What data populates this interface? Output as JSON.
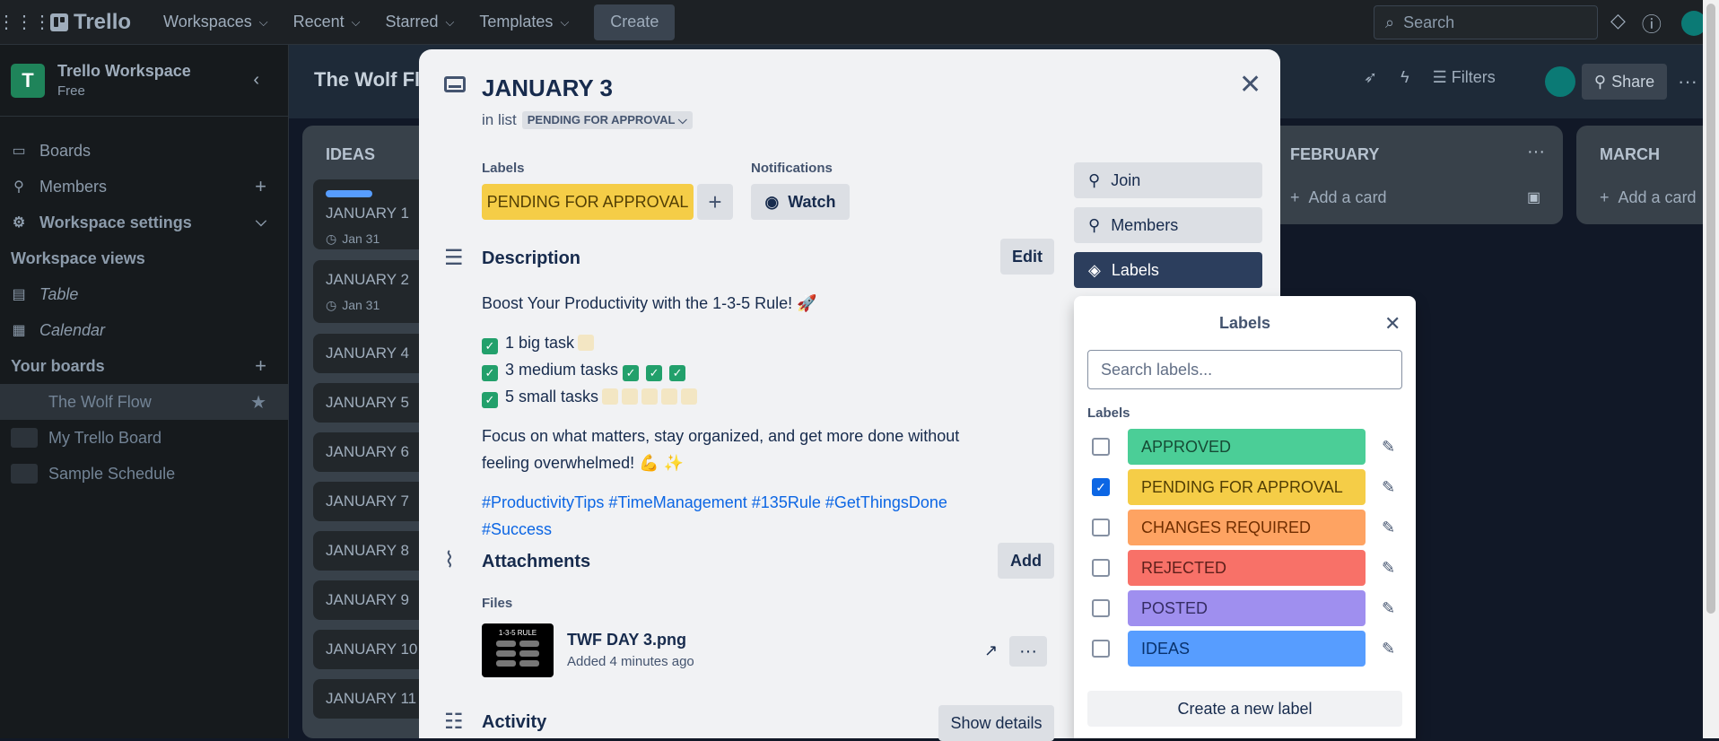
{
  "topbar": {
    "logo": "Trello",
    "nav": [
      "Workspaces",
      "Recent",
      "Starred",
      "Templates"
    ],
    "create": "Create",
    "search_placeholder": "Search"
  },
  "sidebar": {
    "workspace_name": "Trello Workspace",
    "workspace_plan": "Free",
    "items": [
      {
        "label": "Boards"
      },
      {
        "label": "Members"
      },
      {
        "label": "Workspace settings"
      }
    ],
    "views_heading": "Workspace views",
    "views": [
      {
        "label": "Table"
      },
      {
        "label": "Calendar"
      }
    ],
    "boards_heading": "Your boards",
    "boards": [
      {
        "label": "The Wolf Flow"
      },
      {
        "label": "My Trello Board"
      },
      {
        "label": "Sample Schedule"
      }
    ]
  },
  "board": {
    "title": "The Wolf Fl",
    "filters": "Filters",
    "share": "Share",
    "lists": [
      {
        "title": "IDEAS",
        "cards": [
          {
            "title": "JANUARY 1",
            "date": "Jan 31"
          },
          {
            "title": "JANUARY 2",
            "date": "Jan 31"
          },
          {
            "title": "JANUARY 4"
          },
          {
            "title": "JANUARY 5"
          },
          {
            "title": "JANUARY 6"
          },
          {
            "title": "JANUARY 7"
          },
          {
            "title": "JANUARY 8"
          },
          {
            "title": "JANUARY 9"
          },
          {
            "title": "JANUARY 10"
          },
          {
            "title": "JANUARY 11"
          }
        ]
      },
      {
        "title": "FEBRUARY",
        "add_card": "Add a card"
      },
      {
        "title": "MARCH",
        "add_card": "Add a card"
      }
    ]
  },
  "modal": {
    "title": "JANUARY 3",
    "in_list_prefix": "in list",
    "list_name": "PENDING FOR APPROVAL",
    "labels_heading": "Labels",
    "current_label": "PENDING FOR APPROVAL",
    "notifications_heading": "Notifications",
    "watch": "Watch",
    "description_heading": "Description",
    "edit": "Edit",
    "description": {
      "line1": "Boost Your Productivity with the 1-3-5 Rule! 🚀",
      "item1": "1 big task",
      "item2": "3 medium tasks",
      "item3": "5 small tasks",
      "para": "Focus on what matters, stay organized, and get more done without feeling overwhelmed! 💪 ✨",
      "tags": "#ProductivityTips #TimeManagement #135Rule #GetThingsDone #Success"
    },
    "attachments_heading": "Attachments",
    "add": "Add",
    "files_heading": "Files",
    "file": {
      "name": "TWF DAY 3.png",
      "added": "Added 4 minutes ago",
      "thumb_text": "1-3-5 RULE"
    },
    "activity_heading": "Activity",
    "show_details": "Show details",
    "side_buttons": [
      {
        "label": "Join"
      },
      {
        "label": "Members"
      },
      {
        "label": "Labels"
      }
    ]
  },
  "labels_popover": {
    "title": "Labels",
    "search_placeholder": "Search labels...",
    "subheading": "Labels",
    "labels": [
      {
        "name": "APPROVED",
        "color": "#4bce97",
        "text": "#164b35",
        "checked": false
      },
      {
        "name": "PENDING FOR APPROVAL",
        "color": "#f5cd47",
        "text": "#533f04",
        "checked": true
      },
      {
        "name": "CHANGES REQUIRED",
        "color": "#fea362",
        "text": "#702e00",
        "checked": false
      },
      {
        "name": "REJECTED",
        "color": "#f87168",
        "text": "#5d1f1a",
        "checked": false
      },
      {
        "name": "POSTED",
        "color": "#9f8fef",
        "text": "#352c63",
        "checked": false
      },
      {
        "name": "IDEAS",
        "color": "#579dff",
        "text": "#09326c",
        "checked": false
      }
    ],
    "create": "Create a new label"
  }
}
